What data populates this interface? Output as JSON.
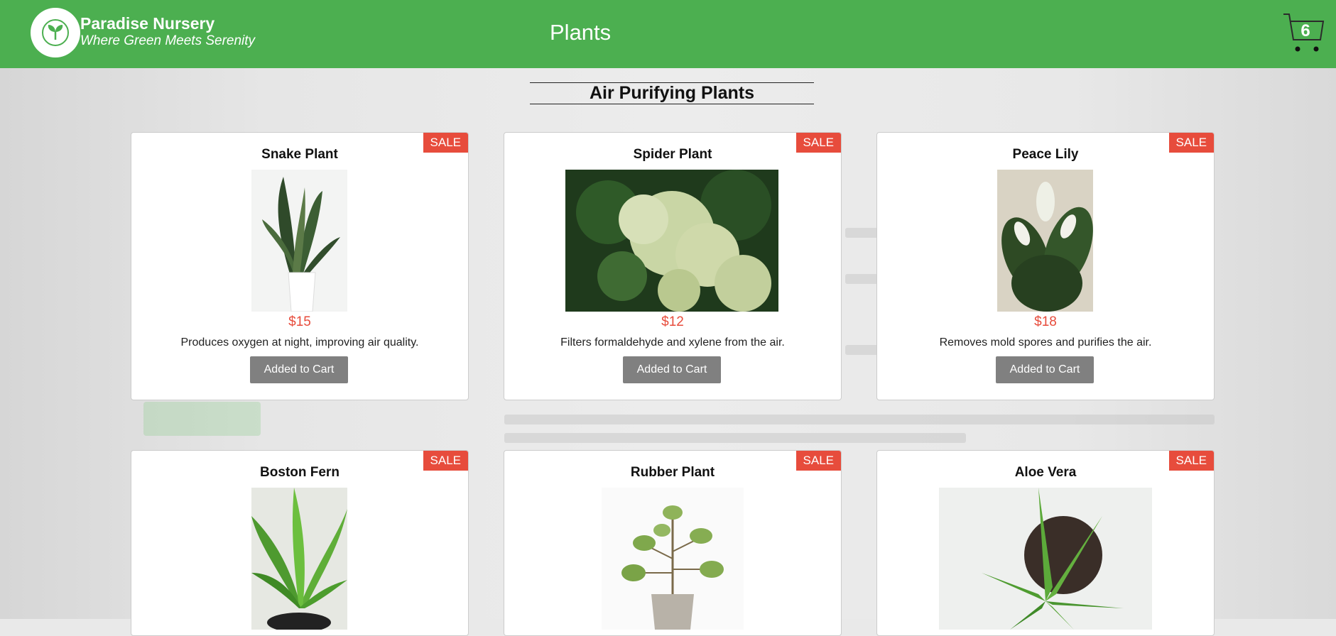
{
  "header": {
    "brand_name": "Paradise Nursery",
    "tagline": "Where Green Meets Serenity",
    "nav_plants": "Plants",
    "cart_count": "6"
  },
  "section": {
    "title": "Air Purifying Plants"
  },
  "cards": [
    {
      "badge": "SALE",
      "name": "Snake Plant",
      "price": "$15",
      "description": "Produces oxygen at night, improving air quality.",
      "button": "Added to Cart"
    },
    {
      "badge": "SALE",
      "name": "Spider Plant",
      "price": "$12",
      "description": "Filters formaldehyde and xylene from the air.",
      "button": "Added to Cart"
    },
    {
      "badge": "SALE",
      "name": "Peace Lily",
      "price": "$18",
      "description": "Removes mold spores and purifies the air.",
      "button": "Added to Cart"
    },
    {
      "badge": "SALE",
      "name": "Boston Fern"
    },
    {
      "badge": "SALE",
      "name": "Rubber Plant"
    },
    {
      "badge": "SALE",
      "name": "Aloe Vera"
    }
  ],
  "colors": {
    "header": "#4caf50",
    "sale_badge": "#e74c3c",
    "price": "#e74c3c",
    "button": "#808080"
  }
}
